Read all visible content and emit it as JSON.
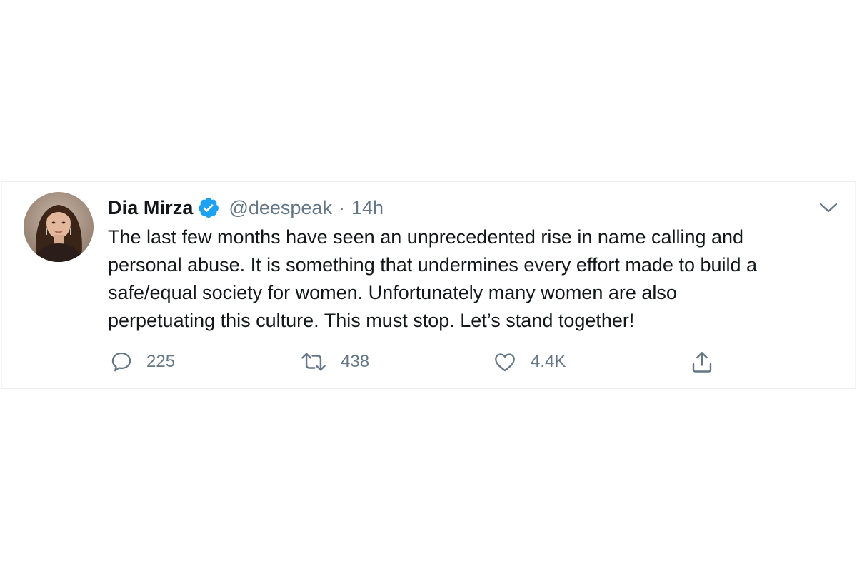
{
  "tweet": {
    "author": {
      "display_name": "Dia Mirza",
      "verified": true,
      "handle": "@deespeak",
      "separator": "·",
      "time": "14h",
      "avatar_icon": "profile-photo"
    },
    "text": "The last few months have seen an unprecedented rise in name calling and\npersonal abuse. It is something that undermines every effort made to build a\nsafe/equal society for women. Unfortunately many women are also\nperpetuating this culture. This must stop. Let’s stand together!",
    "actions": {
      "reply": {
        "icon": "reply-icon",
        "count": "225"
      },
      "retweet": {
        "icon": "retweet-icon",
        "count": "438"
      },
      "like": {
        "icon": "heart-icon",
        "count": "4.4K"
      },
      "share": {
        "icon": "share-icon"
      }
    },
    "menu_icon": "chevron-down-icon"
  },
  "colors": {
    "primary_text": "#14171a",
    "secondary_text": "#657786",
    "verified_blue": "#1da1f2",
    "border": "#ebeef0"
  }
}
